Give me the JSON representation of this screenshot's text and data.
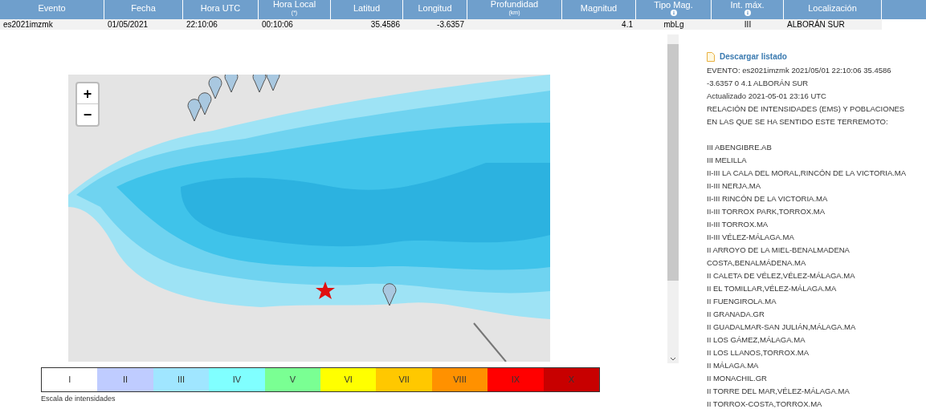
{
  "table": {
    "columns": [
      {
        "label": "Evento"
      },
      {
        "label": "Fecha"
      },
      {
        "label": "Hora UTC"
      },
      {
        "label": "Hora Local",
        "sub": "(*)"
      },
      {
        "label": "Latitud"
      },
      {
        "label": "Longitud"
      },
      {
        "label": "Profundidad",
        "sub": "(km)"
      },
      {
        "label": "Magnitud"
      },
      {
        "label": "Tipo Mag.",
        "info": true
      },
      {
        "label": "Int. máx.",
        "info": true
      },
      {
        "label": "Localización"
      }
    ],
    "rows": [
      {
        "cells": [
          "es2021imzmk",
          "01/05/2021",
          "22:10:06",
          "00:10:06",
          "35.4586",
          "-3.6357",
          "",
          "4.1",
          "mbLg",
          "III",
          "ALBORÁN SUR"
        ]
      }
    ]
  },
  "map": {
    "zoom_in": "+",
    "zoom_out": "−"
  },
  "legend": {
    "items": [
      {
        "label": "I",
        "color": "#ffffff"
      },
      {
        "label": "II",
        "color": "#bfccff"
      },
      {
        "label": "III",
        "color": "#a0e6ff"
      },
      {
        "label": "IV",
        "color": "#80ffff"
      },
      {
        "label": "V",
        "color": "#7aff93"
      },
      {
        "label": "VI",
        "color": "#ffff00"
      },
      {
        "label": "VII",
        "color": "#ffc800"
      },
      {
        "label": "VIII",
        "color": "#ff9100"
      },
      {
        "label": "IX",
        "color": "#ff0000"
      },
      {
        "label": "X",
        "color": "#c80000"
      }
    ],
    "caption": "Escala de intensidades"
  },
  "report": {
    "link": "Descargar listado",
    "lines": [
      "EVENTO: es2021imzmk 2021/05/01 22:10:06 35.4586 -3.6357 0 4.1 ALBORÁN SUR",
      "Actualizado 2021-05-01 23:16 UTC",
      "RELACIÓN DE INTENSIDADES (EMS) Y POBLACIONES EN LAS QUE SE HA SENTIDO ESTE TERREMOTO:"
    ],
    "places": [
      "III ABENGIBRE.AB",
      "III MELILLA",
      "II-III LA CALA DEL MORAL,RINCÓN DE LA VICTORIA.MA",
      "II-III NERJA.MA",
      "II-III RINCÓN DE LA VICTORIA.MA",
      "II-III TORROX PARK,TORROX.MA",
      "II-III TORROX.MA",
      "II-III VÉLEZ-MÁLAGA.MA",
      "II ARROYO DE LA MIEL-BENALMADENA COSTA,BENALMÁDENA.MA",
      "II CALETA DE VÉLEZ,VÉLEZ-MÁLAGA.MA",
      "II EL TOMILLAR,VÉLEZ-MÁLAGA.MA",
      "II FUENGIROLA.MA",
      "II GRANADA.GR",
      "II GUADALMAR-SAN JULIÁN,MÁLAGA.MA",
      "II LOS GÁMEZ,MÁLAGA.MA",
      "II LOS LLANOS,TORROX.MA",
      "II MÁLAGA.MA",
      "II MONACHIL.GR",
      "II TORRE DEL MAR,VÉLEZ-MÁLAGA.MA",
      "II TORROX-COSTA,TORROX.MA"
    ]
  }
}
